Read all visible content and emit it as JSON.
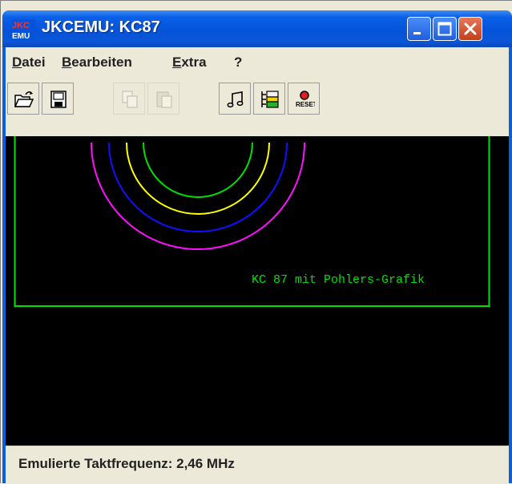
{
  "window": {
    "title": "JKCEMU: KC87"
  },
  "app_icon": {
    "top_text": "JKC",
    "bottom_text": "EMU"
  },
  "menu": {
    "items": [
      {
        "first": "D",
        "rest": "atei"
      },
      {
        "first": "B",
        "rest": "earbeiten"
      },
      {
        "first": "E",
        "rest": "xtra"
      },
      {
        "first": "",
        "rest": "?"
      }
    ]
  },
  "toolbar": {
    "reset_label": "RESET",
    "icons": [
      "open-icon",
      "save-icon",
      "copy-icon",
      "paste-icon",
      "audio-icon",
      "settings-icon",
      "reset-icon"
    ]
  },
  "screen": {
    "caption": "KC 87 mit Pohlers-Grafik"
  },
  "status": {
    "text": "Emulierte Taktfrequenz: 2,46 MHz"
  },
  "colors": {
    "green": "#00e000",
    "yellow": "#ffff00",
    "blue": "#1010ff",
    "magenta": "#ff10ff"
  }
}
